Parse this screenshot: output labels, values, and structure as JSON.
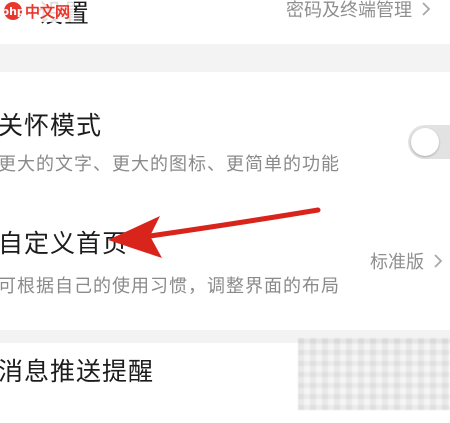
{
  "watermark": {
    "logo_mark": "php",
    "logo_text": "中文网"
  },
  "rows": {
    "security": {
      "title": "设置",
      "value": "密码及终端管理"
    },
    "care_mode": {
      "title": "关怀模式",
      "desc": "更大的文字、更大的图标、更简单的功能",
      "toggle_on": false
    },
    "custom_home": {
      "title": "自定义首页",
      "desc": "可根据自己的使用习惯，调整界面的布局",
      "value": "标准版"
    },
    "push": {
      "title": "消息推送提醒"
    }
  },
  "icons": {
    "chevron": "chevron-right-icon",
    "arrow": "red-arrow-annotation"
  },
  "colors": {
    "arrow": "#d9241b",
    "toggle_off": "#e2e2e2",
    "logo": "#e8372c"
  }
}
